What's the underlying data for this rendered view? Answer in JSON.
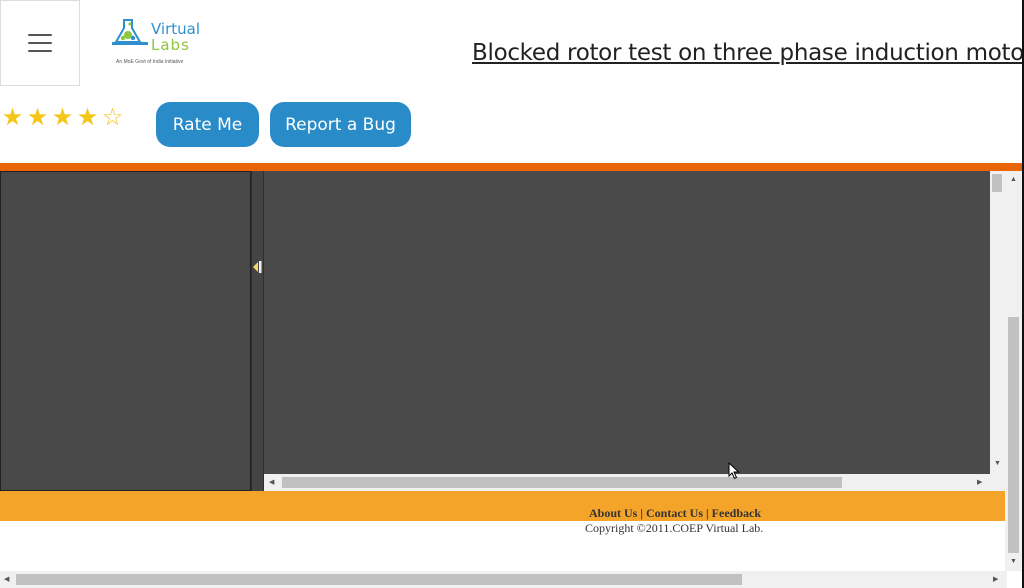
{
  "header": {
    "menu_icon": "hamburger-icon",
    "logo": {
      "line1": "Virtual",
      "line2": "Labs",
      "tagline": "An MoE Govt of India Initiative"
    },
    "title": "Blocked rotor test on three phase induction motor"
  },
  "rating": {
    "filled": 4,
    "total": 5
  },
  "buttons": {
    "rate_label": "Rate Me",
    "bug_label": "Report a Bug"
  },
  "footer": {
    "about": "About Us",
    "contact": "Contact Us",
    "feedback": "Feedback",
    "separator": "|",
    "copyright": "Copyright ©2011.COEP Virtual Lab."
  },
  "colors": {
    "accent_orange": "#e8650a",
    "footer_orange": "#f5a42a",
    "button_blue": "#2a8bc9",
    "star_gold": "#f5c518",
    "workspace_gray": "#4a4a4a"
  }
}
